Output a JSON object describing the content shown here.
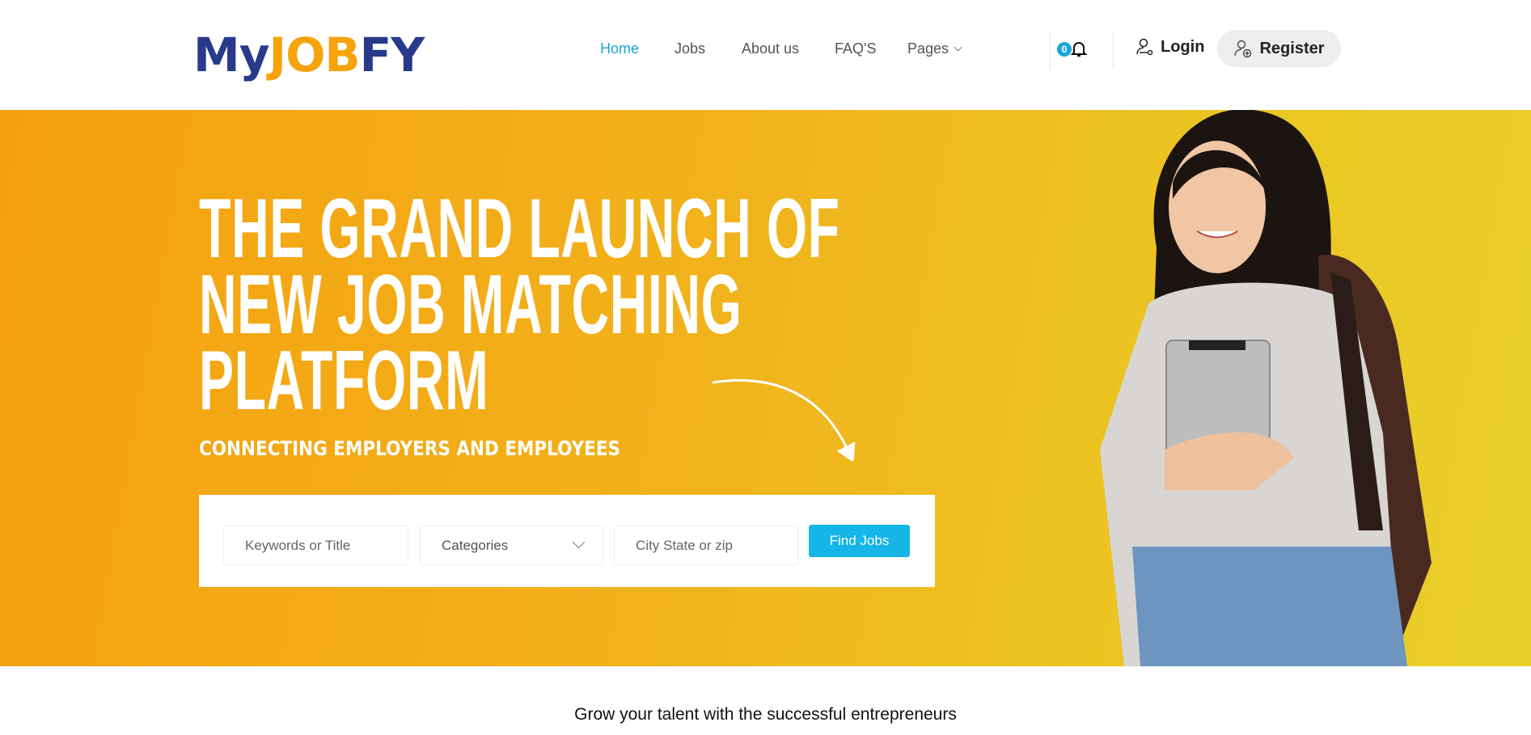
{
  "header": {
    "logo": {
      "part1": "My",
      "part2": "JOB",
      "part3": "FY"
    },
    "nav": [
      {
        "label": "Home",
        "active": true
      },
      {
        "label": "Jobs"
      },
      {
        "label": "About us"
      },
      {
        "label": "FAQ'S"
      },
      {
        "label": "Pages",
        "has_dropdown": true
      }
    ],
    "notifications_count": "0",
    "login_label": "Login",
    "register_label": "Register"
  },
  "hero": {
    "title_lines": [
      "THE GRAND LAUNCH OF",
      "NEW JOB MATCHING",
      "PLATFORM"
    ],
    "subtitle": "CONNECTING EMPLOYERS AND EMPLOYEES",
    "search": {
      "keywords_placeholder": "Keywords or Title",
      "category_selected": "Categories",
      "location_placeholder": "City State or zip",
      "button_label": "Find Jobs"
    }
  },
  "tagline": "Grow your talent with the successful entrepreneurs",
  "colors": {
    "brand_blue": "#283a8c",
    "brand_orange": "#f7a30c",
    "accent": "#15b5e8"
  }
}
